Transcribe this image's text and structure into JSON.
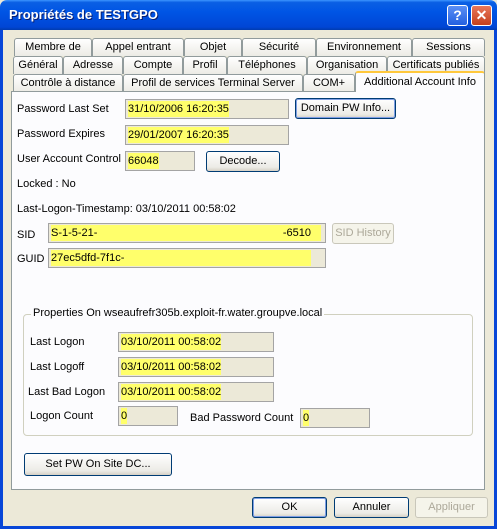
{
  "window": {
    "title": "Propriétés de TESTGPO",
    "help_glyph": "?",
    "close_glyph": "✕"
  },
  "tabs": {
    "row1": [
      "Membre de",
      "Appel entrant",
      "Objet",
      "Sécurité",
      "Environnement",
      "Sessions"
    ],
    "row2": [
      "Général",
      "Adresse",
      "Compte",
      "Profil",
      "Téléphones",
      "Organisation",
      "Certificats publiés"
    ],
    "row3": [
      "Contrôle à distance",
      "Profil de services Terminal Server",
      "COM+",
      "Additional Account Info"
    ],
    "active": "Additional Account Info"
  },
  "account": {
    "password_last_set_label": "Password Last Set",
    "password_last_set_value": "31/10/2006 16:20:35",
    "domain_pw_info_button": "Domain PW Info...",
    "password_expires_label": "Password Expires",
    "password_expires_value": "29/01/2007 16:20:35",
    "uac_label": "User Account Control",
    "uac_value": "66048",
    "decode_button": "Decode...",
    "locked_text": "Locked : No",
    "last_logon_timestamp_text": "Last-Logon-Timestamp: 03/10/2011 00:58:02",
    "sid_label": "SID",
    "sid_value_prefix": "S-1-5-21-",
    "sid_value_suffix": "-6510",
    "sid_history_button": "SID History",
    "guid_label": "GUID",
    "guid_value": "27ec5dfd-7f1c-"
  },
  "properties_group": {
    "title": "Properties On wseaufrefr305b.exploit-fr.water.groupve.local",
    "last_logon_label": "Last Logon",
    "last_logon_value": "03/10/2011 00:58:02",
    "last_logoff_label": "Last Logoff",
    "last_logoff_value": "03/10/2011 00:58:02",
    "last_bad_logon_label": "Last Bad Logon",
    "last_bad_logon_value": "03/10/2011 00:58:02",
    "logon_count_label": "Logon Count",
    "logon_count_value": "0",
    "bad_password_count_label": "Bad Password Count",
    "bad_password_count_value": "0"
  },
  "set_pw_button": "Set PW On Site DC...",
  "footer": {
    "ok": "OK",
    "cancel": "Annuler",
    "apply": "Appliquer"
  },
  "colors": {
    "highlight": "#ffff6b",
    "titlebar": "#0055e5",
    "tab_active_accent": "#ffc83c"
  }
}
